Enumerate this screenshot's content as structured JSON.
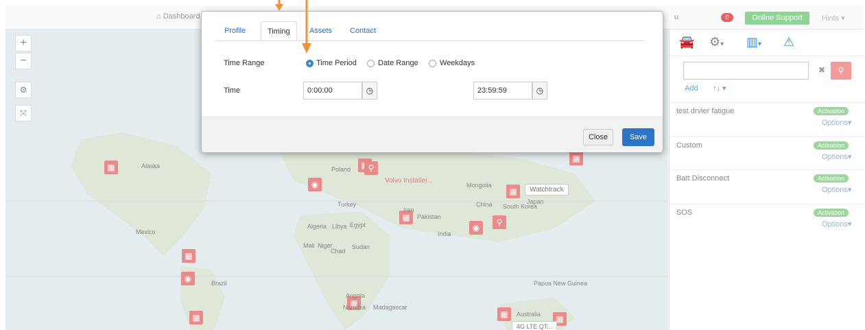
{
  "topbar": {
    "crumb": "Dashboard",
    "crumb_clip": "u",
    "badge": "0",
    "online_support": "Online Support",
    "hints": "Hints"
  },
  "map": {
    "ctrl_plus": "+",
    "ctrl_minus": "−",
    "labels": {
      "volvo": "Volvo Installer...",
      "watchtrack": "Watchtrack",
      "lte": "4G LTE QT...",
      "mongolia": "Mongolia",
      "china": "China",
      "libya": "Libya",
      "egypt": "Egypt",
      "algeria": "Algeria",
      "mali": "Mali",
      "niger": "Niger",
      "chad": "Chad",
      "sudan": "Sudan",
      "iran": "Iran",
      "pakistan": "Pakistan",
      "india": "India",
      "turkey": "Turkey",
      "poland": "Poland",
      "mexico": "Mexico",
      "australia": "Australia",
      "madagascar": "Madagascar",
      "angola": "Angola",
      "namibia": "Namibia",
      "alaska": "Alaska",
      "papua": "Papua New Guinea",
      "south_korea": "South Korea",
      "japan": "Japan",
      "brazil": "Brazil"
    }
  },
  "modal": {
    "tabs": [
      "Profile",
      "Timing",
      "Assets",
      "Contact"
    ],
    "active_tab": "Timing",
    "time_range_label": "Time Range",
    "radio_options": [
      "Time Period",
      "Date Range",
      "Weekdays"
    ],
    "selected_option": "Time Period",
    "time_label": "Time",
    "start_time": "0:00:00",
    "end_time": "23:59:59",
    "close_label": "Close",
    "save_label": "Save"
  },
  "right_panel": {
    "icons": [
      "car-icon",
      "gear-icon",
      "chart-icon",
      "warning-icon"
    ],
    "search_value": "",
    "add_label": "Add",
    "sort_label": "↑↓",
    "rules": [
      {
        "name": "test drvier fatigue",
        "status": "Activation",
        "options": "Options"
      },
      {
        "name": "Custom",
        "status": "Activation",
        "options": "Options"
      },
      {
        "name": "Batt Disconnect",
        "status": "Activation",
        "options": "Options"
      },
      {
        "name": "SOS",
        "status": "Activation",
        "options": "Options"
      }
    ]
  },
  "colors": {
    "accent": "#2b74c7",
    "arrow": "#f0923a",
    "online": "#8fd494",
    "activation": "#9fd69f",
    "pin": "#ea8a89"
  }
}
